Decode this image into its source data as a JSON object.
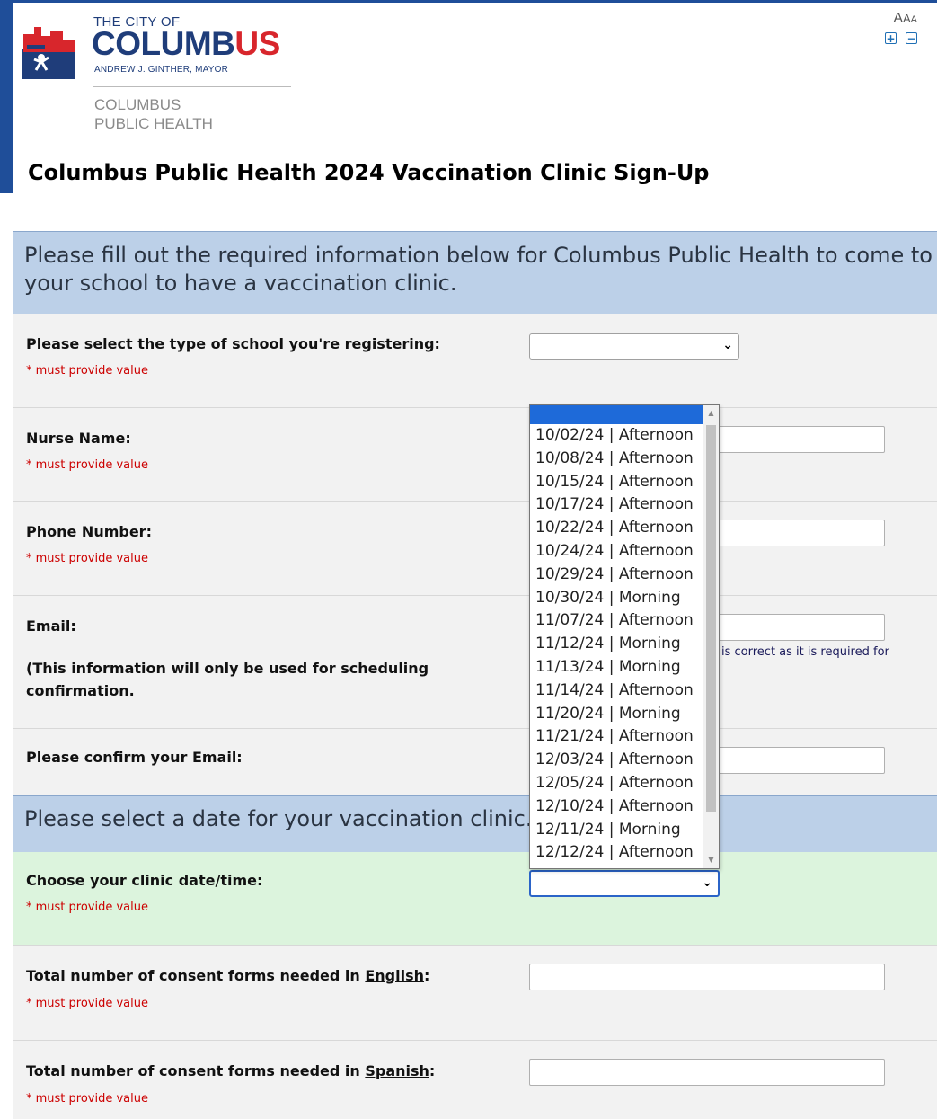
{
  "header": {
    "city_of": "THE CITY OF",
    "columbus_main": "COLUMB",
    "columbus_end": "US",
    "mayor": "ANDREW J. GINTHER, MAYOR",
    "dept_line1": "COLUMBUS",
    "dept_line2": "PUBLIC HEALTH",
    "text_size_label": "AAA"
  },
  "page_title": "Columbus Public Health 2024 Vaccination Clinic Sign-Up",
  "section1": {
    "text": "Please fill out the required information below for Columbus Public Health to come to your school to have a vaccination clinic."
  },
  "section2": {
    "text": "Please select a date for your vaccination clinic."
  },
  "fields": {
    "school_type": {
      "label": "Please select the type of school you're registering:",
      "required": "* must provide value",
      "value": ""
    },
    "nurse_name": {
      "label": "Nurse Name:",
      "required": "* must provide value",
      "value": ""
    },
    "phone": {
      "label": "Phone Number:",
      "required": "* must provide value",
      "value": ""
    },
    "email": {
      "label": "Email:",
      "note": "(This information will only be used for scheduling confirmation.",
      "hint": "is correct as it is required for",
      "value": ""
    },
    "confirm_email": {
      "label": "Please confirm your Email:",
      "value": ""
    },
    "clinic_date": {
      "label": "Choose your clinic date/time:",
      "required": "* must provide value",
      "value": ""
    },
    "consent_english": {
      "label_pre": "Total number of consent forms needed in ",
      "label_lang": "English",
      "label_post": ":",
      "required": "* must provide value",
      "value": ""
    },
    "consent_spanish": {
      "label_pre": "Total number of consent forms needed in ",
      "label_lang": "Spanish",
      "label_post": ":",
      "required": "* must provide value",
      "value": ""
    }
  },
  "dropdown_options": [
    "",
    "10/02/24 | Afternoon",
    "10/08/24 | Afternoon",
    "10/15/24 | Afternoon",
    "10/17/24 | Afternoon",
    "10/22/24 | Afternoon",
    "10/24/24 | Afternoon",
    "10/29/24 | Afternoon",
    "10/30/24 | Morning",
    "11/07/24 | Afternoon",
    "11/12/24 | Morning",
    "11/13/24 | Morning",
    "11/14/24 | Afternoon",
    "11/20/24 | Morning",
    "11/21/24 | Afternoon",
    "12/03/24 | Afternoon",
    "12/05/24 | Afternoon",
    "12/10/24 | Afternoon",
    "12/11/24 | Morning",
    "12/12/24 | Afternoon"
  ],
  "colors": {
    "brand_blue": "#1f3d7a",
    "brand_red": "#d8262c",
    "section_bg": "#bcd0e8",
    "required_red": "#cc0000",
    "highlight_green": "#dcf4dd",
    "selection_blue": "#1e6ad9"
  }
}
